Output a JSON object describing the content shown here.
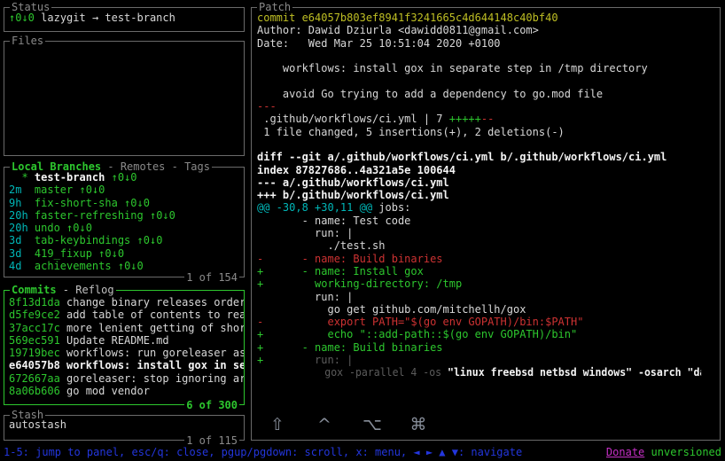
{
  "colors": {
    "background": "#000000",
    "border": "#6a6a6a",
    "border_active": "#2dc72e",
    "green": "#2dc72e",
    "cyan": "#00b7b8",
    "red": "#cd3232",
    "yellow": "#bfbf24",
    "blue": "#2336dd",
    "magenta": "#c62fc6",
    "white": "#d8d8d8",
    "bright_white": "#f4f4f4",
    "dim": "#5c5c5c",
    "gray": "#8a8a8a"
  },
  "status_panel": {
    "title": "Status",
    "push_pull": "↑0↓0",
    "repo_branch": "lazygit → test-branch"
  },
  "files_panel": {
    "title": "Files"
  },
  "branches_panel": {
    "title": "Local Branches",
    "tabs_suffix": " - Remotes - Tags",
    "count": "1 of 154",
    "items": [
      {
        "prefix": "  * ",
        "name": "test-branch",
        "arrows": "↑0↓0",
        "selected": true
      },
      {
        "prefix": "2m  ",
        "name": "master",
        "arrows": "↑0↓0",
        "selected": false
      },
      {
        "prefix": "9h  ",
        "name": "fix-short-sha",
        "arrows": "↑0↓0",
        "selected": false
      },
      {
        "prefix": "20h ",
        "name": "faster-refreshing",
        "arrows": "↑0↓0",
        "selected": false
      },
      {
        "prefix": "20h ",
        "name": "undo",
        "arrows": "↑0↓0",
        "selected": false
      },
      {
        "prefix": "3d  ",
        "name": "tab-keybindings",
        "arrows": "↑0↓0",
        "selected": false
      },
      {
        "prefix": "3d  ",
        "name": "419_fixup",
        "arrows": "↑0↓0",
        "selected": false
      },
      {
        "prefix": "4d  ",
        "name": "achievements",
        "arrows": "↑0↓0",
        "selected": false
      }
    ]
  },
  "commits_panel": {
    "title": "Commits",
    "tabs_suffix": " - Reflog",
    "count": "6 of 300",
    "items": [
      {
        "sha": "8f13d1da",
        "message": "change binary releases order",
        "selected": false
      },
      {
        "sha": "d5fe9ce2",
        "message": "add table of contents to rea",
        "selected": false
      },
      {
        "sha": "37acc17c",
        "message": "more lenient getting of shor",
        "selected": false
      },
      {
        "sha": "569ec591",
        "message": "Update README.md",
        "selected": false
      },
      {
        "sha": "19719bec",
        "message": "workflows: run goreleaser as",
        "selected": false
      },
      {
        "sha": "e64057b8",
        "message": "workflows: install gox in se",
        "selected": true
      },
      {
        "sha": "672667aa",
        "message": "goreleaser: stop ignoring ar",
        "selected": false
      },
      {
        "sha": "8a06b606",
        "message": "go mod vendor",
        "selected": false
      }
    ]
  },
  "stash_panel": {
    "title": "Stash",
    "count": "1 of 115",
    "items": [
      {
        "name": "autostash"
      }
    ]
  },
  "patch_panel": {
    "title": "Patch",
    "lines": [
      {
        "segments": [
          {
            "t": "commit e64057b803ef8941f3241665c4d644148c40bf40",
            "c": "yellow"
          }
        ]
      },
      {
        "segments": [
          {
            "t": "Author: Dawid Dziurla <dawidd0811@gmail.com>",
            "c": "white"
          }
        ]
      },
      {
        "segments": [
          {
            "t": "Date:   Wed Mar 25 10:51:04 2020 +0100",
            "c": "white"
          }
        ]
      },
      {
        "segments": []
      },
      {
        "segments": [
          {
            "t": "    workflows: install gox in separate step in /tmp directory",
            "c": "white"
          }
        ]
      },
      {
        "segments": []
      },
      {
        "segments": [
          {
            "t": "    avoid Go trying to add a dependency to go.mod file",
            "c": "white"
          }
        ]
      },
      {
        "segments": [
          {
            "t": "---",
            "c": "red"
          }
        ]
      },
      {
        "segments": [
          {
            "t": " .github/workflows/ci.yml | 7 ",
            "c": "white"
          },
          {
            "t": "+++++",
            "c": "green"
          },
          {
            "t": "--",
            "c": "red"
          }
        ]
      },
      {
        "segments": [
          {
            "t": " 1 file changed, 5 insertions(+), 2 deletions(-)",
            "c": "white"
          }
        ]
      },
      {
        "segments": []
      },
      {
        "segments": [
          {
            "t": "diff --git a/.github/workflows/ci.yml b/.github/workflows/ci.yml",
            "c": "boldwhite"
          }
        ]
      },
      {
        "segments": [
          {
            "t": "index 87827686..4a321a5e 100644",
            "c": "boldwhite"
          }
        ]
      },
      {
        "segments": [
          {
            "t": "--- a/.github/workflows/ci.yml",
            "c": "boldwhite"
          }
        ]
      },
      {
        "segments": [
          {
            "t": "+++ b/.github/workflows/ci.yml",
            "c": "boldwhite"
          }
        ]
      },
      {
        "segments": [
          {
            "t": "@@ -30,8 +30,11 @@",
            "c": "cyan"
          },
          {
            "t": " jobs:",
            "c": "white"
          }
        ]
      },
      {
        "segments": [
          {
            "t": "       - name: Test code",
            "c": "white"
          }
        ]
      },
      {
        "segments": [
          {
            "t": "         run: |",
            "c": "white"
          }
        ]
      },
      {
        "segments": [
          {
            "t": "           ./test.sh",
            "c": "white"
          }
        ]
      },
      {
        "segments": [
          {
            "t": "-      - name: Build binaries",
            "c": "red"
          }
        ]
      },
      {
        "segments": [
          {
            "t": "+      - name: Install gox",
            "c": "green"
          }
        ]
      },
      {
        "segments": [
          {
            "t": "+        working-directory: /tmp",
            "c": "green"
          }
        ]
      },
      {
        "segments": [
          {
            "t": "         run: |",
            "c": "white"
          }
        ]
      },
      {
        "segments": [
          {
            "t": "           go get github.com/mitchellh/gox",
            "c": "white"
          }
        ]
      },
      {
        "segments": [
          {
            "t": "-          export PATH=\"$(go env GOPATH)/bin:$PATH\"",
            "c": "red"
          }
        ]
      },
      {
        "segments": [
          {
            "t": "+          echo \"::add-path::$(go env GOPATH)/bin\"",
            "c": "green"
          }
        ]
      },
      {
        "segments": [
          {
            "t": "+      - name: Build binaries",
            "c": "green"
          }
        ]
      },
      {
        "segments": [
          {
            "t": "+",
            "c": "green"
          },
          {
            "t": "        run: |",
            "c": "dim"
          }
        ]
      },
      {
        "squeeze": true,
        "segments": [
          {
            "t": "           gox -parallel 4 -os",
            "c": "dim"
          },
          {
            "t": " \"linux freebsd netbsd windows\" -osarch \"darw",
            "c": "boldwhite"
          }
        ]
      }
    ]
  },
  "modifier_keys": [
    {
      "icon": "shift-icon",
      "glyph": "⇧"
    },
    {
      "icon": "control-icon",
      "glyph": "^"
    },
    {
      "icon": "option-icon",
      "glyph": "⌥"
    },
    {
      "icon": "command-icon",
      "glyph": "⌘"
    }
  ],
  "status_bar": {
    "keybindings": "1-5: jump to panel, esc/q: close, pgup/pgdown: scroll, x: menu, ◄ ► ▲ ▼: navigate",
    "donate_label": "Donate",
    "version_label": "unversioned"
  }
}
